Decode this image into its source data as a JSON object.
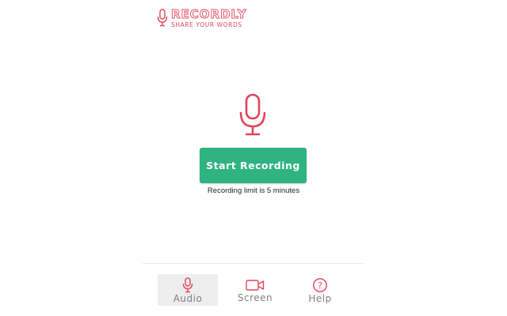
{
  "logo": {
    "brand": "RECORDLY",
    "tagline": "SHARE YOUR WORDS"
  },
  "main": {
    "start_label": "Start Recording",
    "limit_text": "Recording limit is 5 minutes"
  },
  "tabs": [
    {
      "label": "Audio",
      "icon": "microphone-icon",
      "active": true
    },
    {
      "label": "Screen",
      "icon": "video-camera-icon",
      "active": false
    },
    {
      "label": "Help",
      "icon": "help-icon",
      "active": false
    }
  ],
  "colors": {
    "accent_red": "#e0455c",
    "button_green": "#2fb381",
    "tab_text": "#7f7f7f"
  }
}
